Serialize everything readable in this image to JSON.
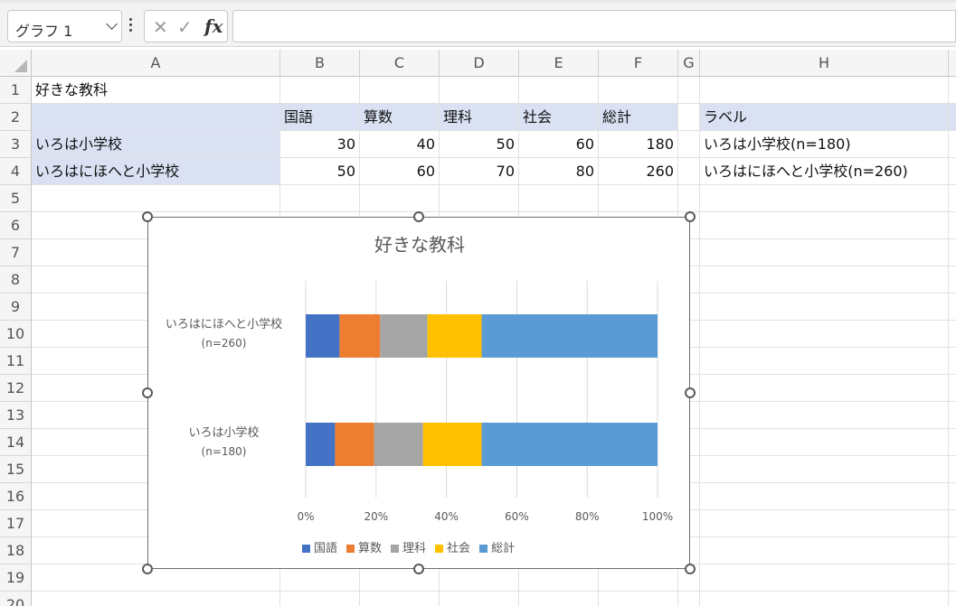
{
  "formula_bar": {
    "name_box": "グラフ 1",
    "cancel_glyph": "✕",
    "enter_glyph": "✓",
    "fx_label": "fx",
    "formula": ""
  },
  "columns": [
    "A",
    "B",
    "C",
    "D",
    "E",
    "F",
    "G",
    "H"
  ],
  "rows": [
    "1",
    "2",
    "3",
    "4",
    "5",
    "6",
    "7",
    "8",
    "9",
    "10",
    "11",
    "12",
    "13",
    "14",
    "15",
    "16",
    "17",
    "18",
    "19",
    "20"
  ],
  "sheet": {
    "a1": "好きな教科",
    "headers": [
      "国語",
      "算数",
      "理科",
      "社会",
      "総計"
    ],
    "h2": "ラベル",
    "data_rows": [
      {
        "school": "いろは小学校",
        "values": [
          "30",
          "40",
          "50",
          "60",
          "180"
        ],
        "label": "いろは小学校(n=180)"
      },
      {
        "school": "いろはにほへと小学校",
        "values": [
          "50",
          "60",
          "70",
          "80",
          "260"
        ],
        "label": "いろはにほへと小学校(n=260)"
      }
    ]
  },
  "chart_data": {
    "type": "bar",
    "orientation": "horizontal",
    "stacked": "100%",
    "title": "好きな教科",
    "categories": [
      {
        "line1": "いろはにほへと小学校",
        "line2": "(n=260)"
      },
      {
        "line1": "いろは小学校",
        "line2": "(n=180)"
      }
    ],
    "series": [
      {
        "name": "国語",
        "values": [
          50,
          30
        ],
        "color": "#4472c4"
      },
      {
        "name": "算数",
        "values": [
          60,
          40
        ],
        "color": "#ed7d31"
      },
      {
        "name": "理科",
        "values": [
          70,
          50
        ],
        "color": "#a5a5a5"
      },
      {
        "name": "社会",
        "values": [
          80,
          60
        ],
        "color": "#ffc000"
      },
      {
        "name": "総計",
        "values": [
          260,
          180
        ],
        "color": "#5b9bd5"
      }
    ],
    "x_ticks": [
      "0%",
      "20%",
      "40%",
      "60%",
      "80%",
      "100%"
    ],
    "xlim": [
      0,
      1
    ],
    "grid": true,
    "legend": "bottom"
  }
}
